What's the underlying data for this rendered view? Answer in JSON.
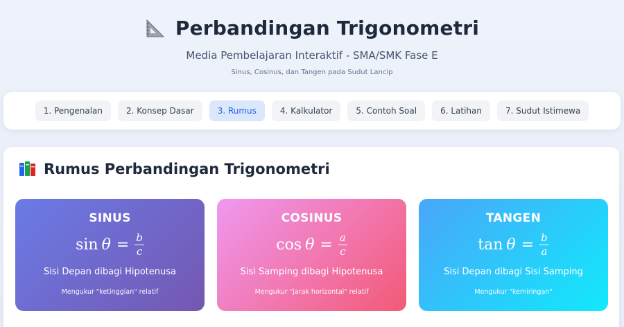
{
  "header": {
    "title": "Perbandingan Trigonometri",
    "subtitle": "Media Pembelajaran Interaktif - SMA/SMK Fase E",
    "subnote": "Sinus, Cosinus, dan Tangen pada Sudut Lancip"
  },
  "nav": {
    "active_index": 2,
    "tabs": [
      {
        "label": "1. Pengenalan"
      },
      {
        "label": "2. Konsep Dasar"
      },
      {
        "label": "3. Rumus"
      },
      {
        "label": "4. Kalkulator"
      },
      {
        "label": "5. Contoh Soal"
      },
      {
        "label": "6. Latihan"
      },
      {
        "label": "7. Sudut Istimewa"
      }
    ]
  },
  "section": {
    "title": "Rumus Perbandingan Trigonometri",
    "icon": "books-icon"
  },
  "cards": [
    {
      "title": "SINUS",
      "func": "sin",
      "theta": "θ",
      "equals": "=",
      "numerator": "b",
      "denominator": "c",
      "description": "Sisi Depan dibagi Hipotenusa",
      "note": "Mengukur \"ketinggian\" relatif",
      "colors": [
        "#6a7be6",
        "#7557b1"
      ]
    },
    {
      "title": "COSINUS",
      "func": "cos",
      "theta": "θ",
      "equals": "=",
      "numerator": "a",
      "denominator": "c",
      "description": "Sisi Samping dibagi Hipotenusa",
      "note": "Mengukur \"jarak horizontal\" relatif",
      "colors": [
        "#ef98f0",
        "#f35a76"
      ]
    },
    {
      "title": "TANGEN",
      "func": "tan",
      "theta": "θ",
      "equals": "=",
      "numerator": "b",
      "denominator": "a",
      "description": "Sisi Depan dibagi Sisi Samping",
      "note": "Mengukur \"kemiringan\"",
      "colors": [
        "#4aa6fa",
        "#11e9fb"
      ]
    }
  ],
  "colors": {
    "active_tab_bg": "#dbe7fb",
    "active_tab_text": "#2563eb",
    "title_text": "#1e293b"
  }
}
